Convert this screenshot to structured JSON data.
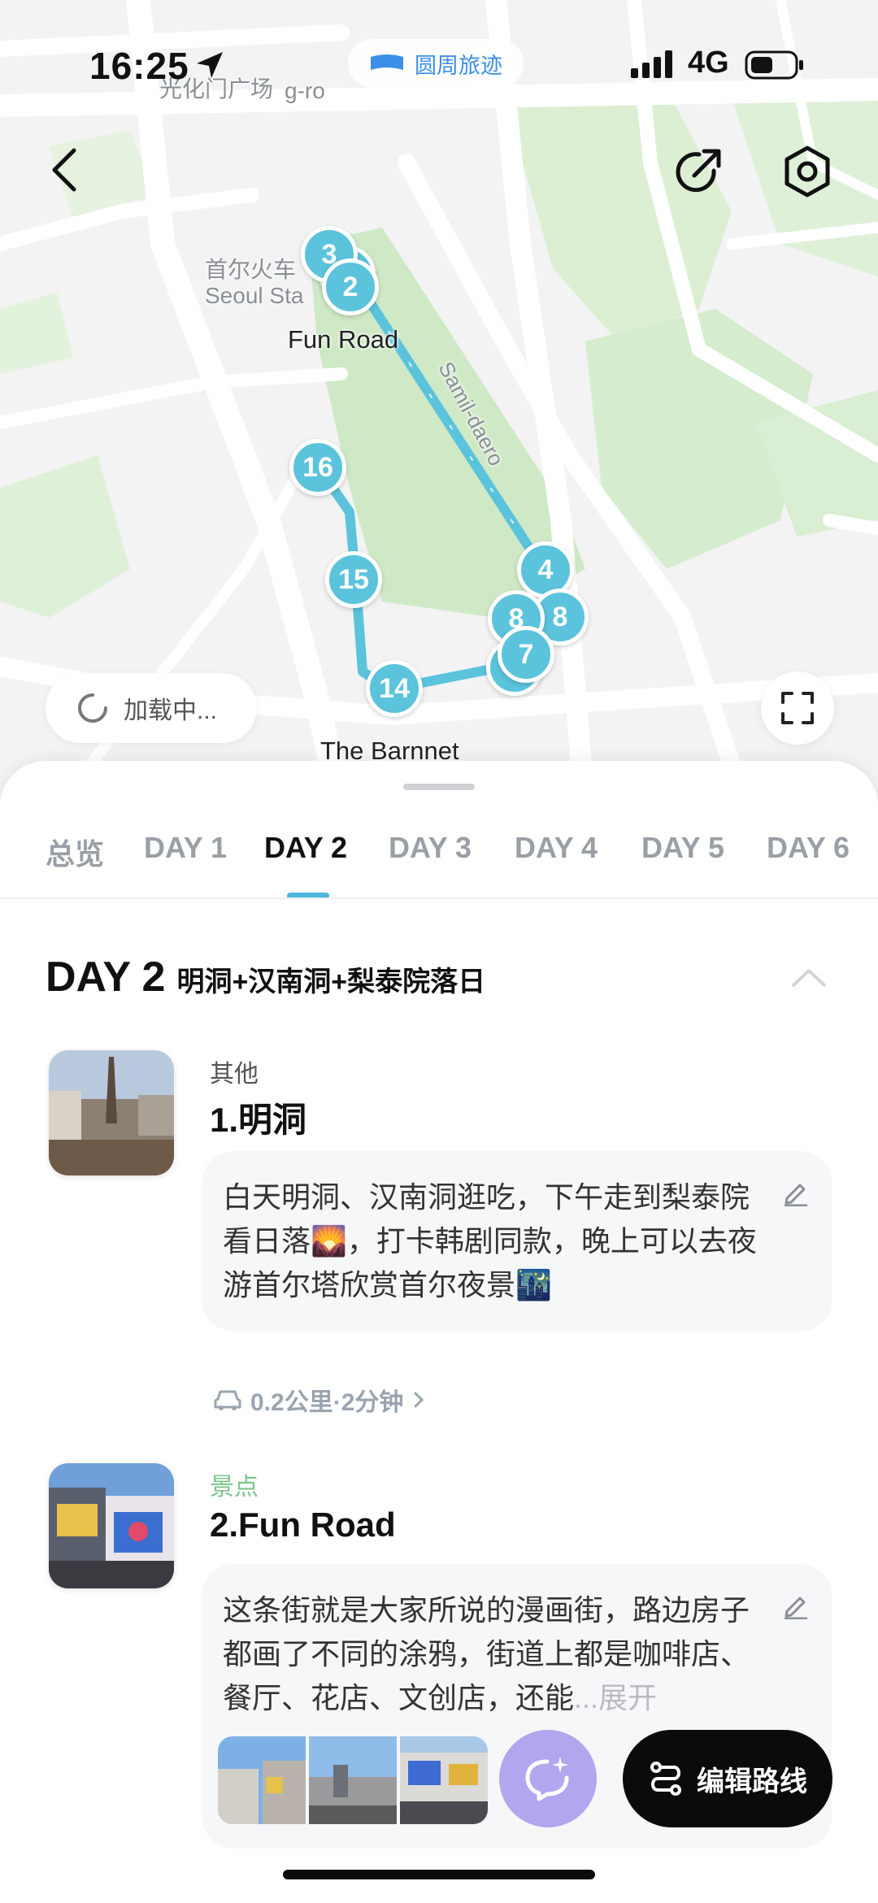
{
  "status_bar": {
    "time": "16:25",
    "app_pill": "圆周旅迹",
    "network": "4G"
  },
  "map": {
    "labels": {
      "square": "光化门广场",
      "road_fragment": "g-ro",
      "station_cn": "首尔火车",
      "station_en": "Seoul Sta",
      "fun_road": "Fun Road",
      "samil": "Samil-daero",
      "barnett": "The Barnnet"
    },
    "pins": [
      "3",
      "2",
      "16",
      "15",
      "14",
      "4",
      "8",
      "8",
      "7"
    ],
    "loading_text": "加载中..."
  },
  "tabs": [
    "总览",
    "DAY 1",
    "DAY 2",
    "DAY 3",
    "DAY 4",
    "DAY 5",
    "DAY 6"
  ],
  "active_tab": "DAY 2",
  "day": {
    "title": "DAY 2",
    "subtitle": "明洞+汉南洞+梨泰院落日"
  },
  "items": [
    {
      "category": "其他",
      "category_color": "#555555",
      "name": "1.明洞",
      "note": "白天明洞、汉南洞逛吃，下午走到梨泰院看日落🌄，打卡韩剧同款，晚上可以去夜游首尔塔欣赏首尔夜景🌃"
    },
    {
      "category": "景点",
      "category_color": "#7cc48a",
      "name": "2.Fun Road",
      "note": "这条街就是大家所说的漫画街，路边房子都画了不同的涂鸦，街道上都是咖啡店、餐厅、花店、文创店，还能",
      "expand": "...展开"
    }
  ],
  "transit": {
    "text": "0.2公里·2分钟"
  },
  "actions": {
    "edit_route": "编辑路线"
  },
  "colors": {
    "route": "#5bc3dc",
    "accent": "#4cb6dc",
    "ai_button": "#b3a6ef"
  }
}
